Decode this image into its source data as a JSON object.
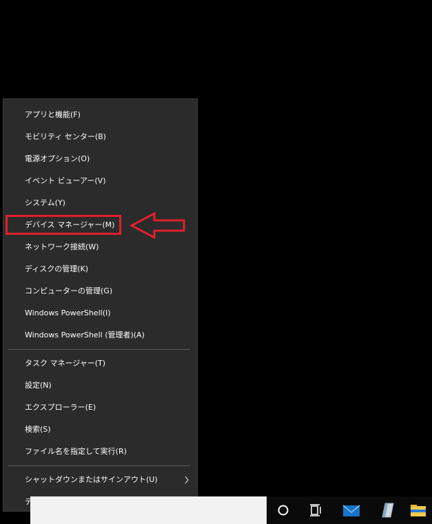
{
  "context_menu": {
    "groups": [
      [
        {
          "label": "アプリと機能(F)"
        },
        {
          "label": "モビリティ センター(B)"
        },
        {
          "label": "電源オプション(O)"
        },
        {
          "label": "イベント ビューアー(V)"
        },
        {
          "label": "システム(Y)"
        },
        {
          "label": "デバイス マネージャー(M)"
        },
        {
          "label": "ネットワーク接続(W)"
        },
        {
          "label": "ディスクの管理(K)"
        },
        {
          "label": "コンピューターの管理(G)"
        },
        {
          "label": "Windows PowerShell(I)"
        },
        {
          "label": "Windows PowerShell (管理者)(A)"
        }
      ],
      [
        {
          "label": "タスク マネージャー(T)"
        },
        {
          "label": "設定(N)"
        },
        {
          "label": "エクスプローラー(E)"
        },
        {
          "label": "検索(S)"
        },
        {
          "label": "ファイル名を指定して実行(R)"
        }
      ],
      [
        {
          "label": "シャットダウンまたはサインアウト(U)",
          "has_submenu": true
        },
        {
          "label": "デスクトップ(D)"
        }
      ]
    ],
    "highlighted_item": "デバイス マネージャー(M)"
  },
  "annotation": {
    "highlight_color": "#e0202a",
    "arrow_icon": "left-arrow-outline"
  },
  "taskbar": {
    "icons": [
      "cortana-circle-icon",
      "task-view-icon",
      "mail-icon",
      "notepad-icon",
      "file-explorer-icon"
    ]
  }
}
